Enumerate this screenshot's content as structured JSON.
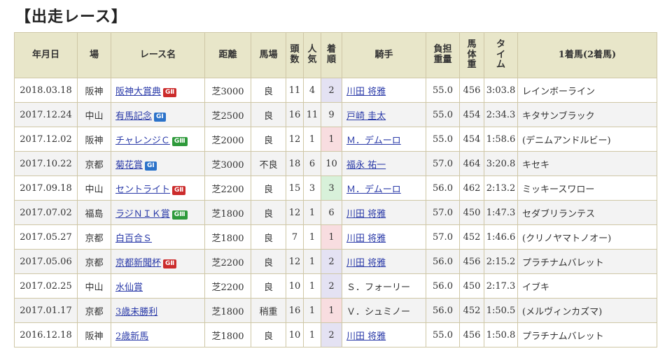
{
  "title": "【出走レース】",
  "headers": [
    "年月日",
    "場",
    "レース名",
    "距離",
    "馬場",
    "頭数",
    "人気",
    "着順",
    "騎手",
    "負担重量",
    "馬体重",
    "タイム",
    "1着馬(2着馬)"
  ],
  "rows": [
    {
      "date": "2018.03.18",
      "track": "阪神",
      "race": "阪神大賞典",
      "grade": "GⅡ",
      "grade_color": "#cc2c2c",
      "dist": "芝3000",
      "cond": "良",
      "heads": "11",
      "pop": "4",
      "pos": "2",
      "jockey": "川田 将雅",
      "jockey_link": true,
      "wt": "55.0",
      "bw": "456",
      "time": "3:03.8",
      "winner": "レインボーライン"
    },
    {
      "date": "2017.12.24",
      "track": "中山",
      "race": "有馬記念",
      "grade": "GⅠ",
      "grade_color": "#2b72c9",
      "dist": "芝2500",
      "cond": "良",
      "heads": "16",
      "pop": "11",
      "pos": "9",
      "jockey": "戸崎 圭太",
      "jockey_link": true,
      "wt": "55.0",
      "bw": "454",
      "time": "2:34.3",
      "winner": "キタサンブラック"
    },
    {
      "date": "2017.12.02",
      "track": "阪神",
      "race": "チャレンジＣ",
      "grade": "GⅢ",
      "grade_color": "#2e9a3b",
      "dist": "芝2000",
      "cond": "良",
      "heads": "12",
      "pop": "1",
      "pos": "1",
      "jockey": "Ｍ．デムーロ",
      "jockey_link": true,
      "wt": "55.0",
      "bw": "454",
      "time": "1:58.6",
      "winner": "(デニムアンドルビー)"
    },
    {
      "date": "2017.10.22",
      "track": "京都",
      "race": "菊花賞",
      "grade": "GⅠ",
      "grade_color": "#2b72c9",
      "dist": "芝3000",
      "cond": "不良",
      "heads": "18",
      "pop": "6",
      "pos": "10",
      "jockey": "福永 祐一",
      "jockey_link": true,
      "wt": "57.0",
      "bw": "464",
      "time": "3:20.8",
      "winner": "キセキ"
    },
    {
      "date": "2017.09.18",
      "track": "中山",
      "race": "セントライト",
      "grade": "GⅡ",
      "grade_color": "#cc2c2c",
      "dist": "芝2200",
      "cond": "良",
      "heads": "15",
      "pop": "3",
      "pos": "3",
      "jockey": "Ｍ．デムーロ",
      "jockey_link": true,
      "wt": "56.0",
      "bw": "462",
      "time": "2:13.2",
      "winner": "ミッキースワロー"
    },
    {
      "date": "2017.07.02",
      "track": "福島",
      "race": "ラジＮＩＫ賞",
      "grade": "GⅢ",
      "grade_color": "#2e9a3b",
      "dist": "芝1800",
      "cond": "良",
      "heads": "12",
      "pop": "1",
      "pos": "6",
      "jockey": "川田 将雅",
      "jockey_link": true,
      "wt": "57.0",
      "bw": "450",
      "time": "1:47.3",
      "winner": "セダブリランテス"
    },
    {
      "date": "2017.05.27",
      "track": "京都",
      "race": "白百合Ｓ",
      "grade": "",
      "grade_color": "",
      "dist": "芝1800",
      "cond": "良",
      "heads": "7",
      "pop": "1",
      "pos": "1",
      "jockey": "川田 将雅",
      "jockey_link": true,
      "wt": "57.0",
      "bw": "452",
      "time": "1:46.6",
      "winner": "(クリノヤマトノオー)"
    },
    {
      "date": "2017.05.06",
      "track": "京都",
      "race": "京都新聞杯",
      "grade": "GⅡ",
      "grade_color": "#cc2c2c",
      "dist": "芝2200",
      "cond": "良",
      "heads": "12",
      "pop": "1",
      "pos": "2",
      "jockey": "川田 将雅",
      "jockey_link": true,
      "wt": "56.0",
      "bw": "456",
      "time": "2:15.2",
      "winner": "プラチナムバレット"
    },
    {
      "date": "2017.02.25",
      "track": "中山",
      "race": "水仙賞",
      "grade": "",
      "grade_color": "",
      "dist": "芝2200",
      "cond": "良",
      "heads": "10",
      "pop": "1",
      "pos": "2",
      "jockey": "Ｓ．フォーリー",
      "jockey_link": false,
      "wt": "56.0",
      "bw": "450",
      "time": "2:17.3",
      "winner": "イブキ"
    },
    {
      "date": "2017.01.17",
      "track": "京都",
      "race": "3歳未勝利",
      "grade": "",
      "grade_color": "",
      "dist": "芝1800",
      "cond": "稍重",
      "heads": "16",
      "pop": "1",
      "pos": "1",
      "jockey": "Ｖ．シュミノー",
      "jockey_link": false,
      "wt": "56.0",
      "bw": "452",
      "time": "1:50.5",
      "winner": "(メルヴィンカズマ)"
    },
    {
      "date": "2016.12.18",
      "track": "阪神",
      "race": "2歳新馬",
      "grade": "",
      "grade_color": "",
      "dist": "芝1800",
      "cond": "良",
      "heads": "10",
      "pop": "1",
      "pos": "2",
      "jockey": "川田 将雅",
      "jockey_link": true,
      "wt": "55.0",
      "bw": "456",
      "time": "1:50.8",
      "winner": "プラチナムバレット"
    }
  ]
}
